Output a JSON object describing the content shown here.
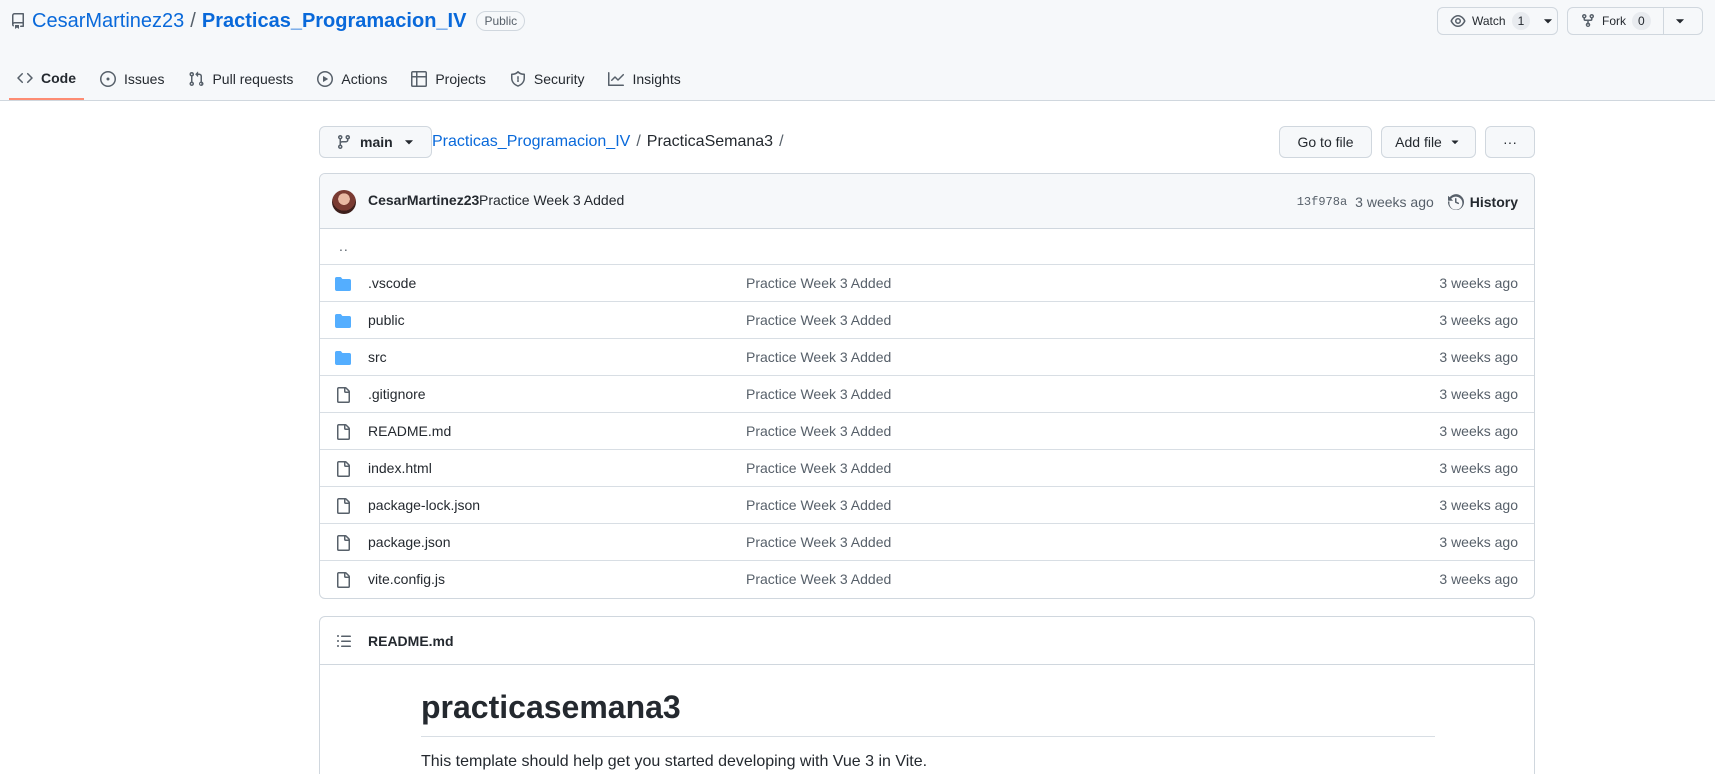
{
  "repo": {
    "owner": "CesarMartinez23",
    "separator": "/",
    "name": "Practicas_Programacion_IV",
    "visibility": "Public"
  },
  "header_buttons": {
    "watch": {
      "label": "Watch",
      "count": "1"
    },
    "fork": {
      "label": "Fork",
      "count": "0"
    }
  },
  "tabs": [
    {
      "label": "Code",
      "icon": "code-icon",
      "active": true
    },
    {
      "label": "Issues",
      "icon": "issue-opened-icon"
    },
    {
      "label": "Pull requests",
      "icon": "git-pull-request-icon"
    },
    {
      "label": "Actions",
      "icon": "play-icon"
    },
    {
      "label": "Projects",
      "icon": "table-icon"
    },
    {
      "label": "Security",
      "icon": "shield-icon"
    },
    {
      "label": "Insights",
      "icon": "graph-icon"
    }
  ],
  "toolbar": {
    "branch": "main",
    "breadcrumb_repo": "Practicas_Programacion_IV",
    "breadcrumb_sep": "/",
    "breadcrumb_folder": "PracticaSemana3",
    "breadcrumb_trailing": "/",
    "go_to_file": "Go to file",
    "add_file": "Add file",
    "more": "···"
  },
  "latest_commit": {
    "author": "CesarMartinez23",
    "message": "Practice Week 3 Added",
    "sha": "13f978a",
    "age": "3 weeks ago",
    "history_label": "History"
  },
  "parent_dir": "..",
  "files": [
    {
      "name": ".vscode",
      "type": "folder",
      "message": "Practice Week 3 Added",
      "age": "3 weeks ago"
    },
    {
      "name": "public",
      "type": "folder",
      "message": "Practice Week 3 Added",
      "age": "3 weeks ago"
    },
    {
      "name": "src",
      "type": "folder",
      "message": "Practice Week 3 Added",
      "age": "3 weeks ago"
    },
    {
      "name": ".gitignore",
      "type": "file",
      "message": "Practice Week 3 Added",
      "age": "3 weeks ago"
    },
    {
      "name": "README.md",
      "type": "file",
      "message": "Practice Week 3 Added",
      "age": "3 weeks ago"
    },
    {
      "name": "index.html",
      "type": "file",
      "message": "Practice Week 3 Added",
      "age": "3 weeks ago"
    },
    {
      "name": "package-lock.json",
      "type": "file",
      "message": "Practice Week 3 Added",
      "age": "3 weeks ago"
    },
    {
      "name": "package.json",
      "type": "file",
      "message": "Practice Week 3 Added",
      "age": "3 weeks ago"
    },
    {
      "name": "vite.config.js",
      "type": "file",
      "message": "Practice Week 3 Added",
      "age": "3 weeks ago"
    }
  ],
  "readme": {
    "filename": "README.md",
    "heading": "practicasemana3",
    "text": "This template should help get you started developing with Vue 3 in Vite."
  },
  "colors": {
    "link": "#0969da",
    "folder": "#54aeff",
    "active_tab_underline": "#fd8c73",
    "muted": "#57606a",
    "border": "#d0d7de"
  }
}
